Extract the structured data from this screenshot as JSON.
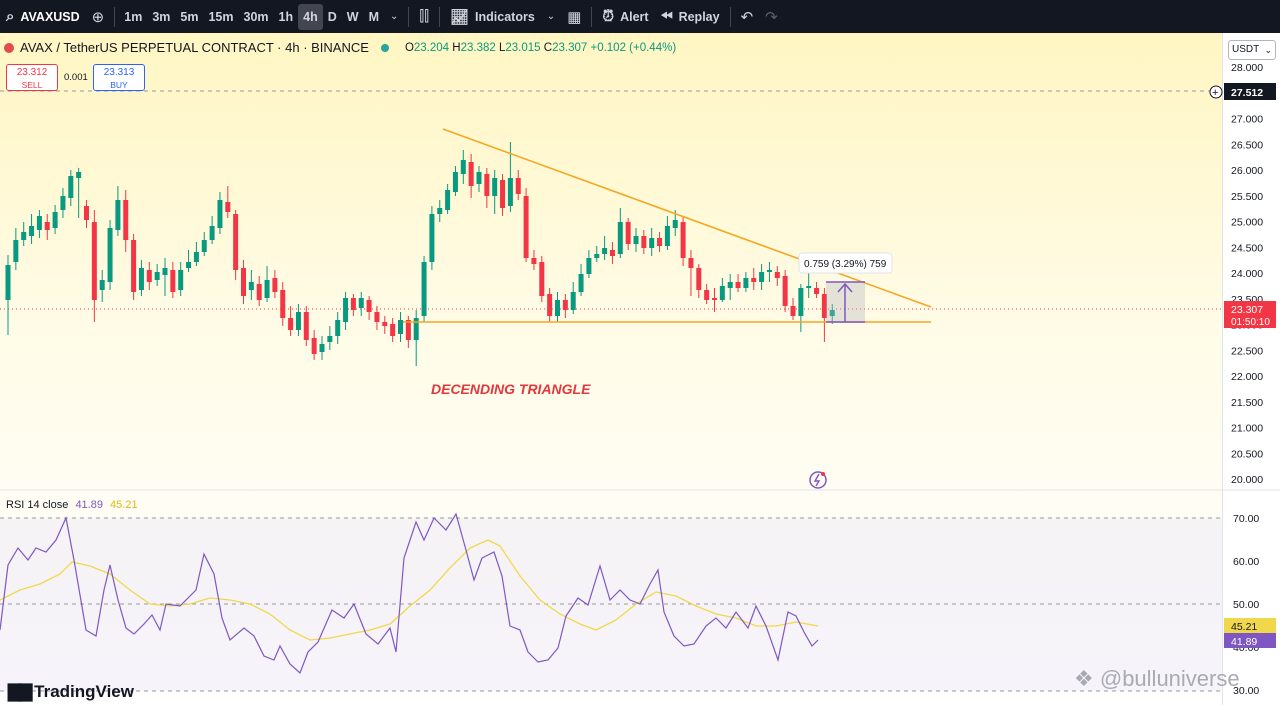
{
  "toolbar": {
    "symbol": "AVAXUSD",
    "intervals": [
      "1m",
      "3m",
      "5m",
      "15m",
      "30m",
      "1h",
      "4h",
      "D",
      "W",
      "M"
    ],
    "active_interval": "4h",
    "indicators_label": "Indicators",
    "alert_label": "Alert",
    "replay_label": "Replay"
  },
  "legend": {
    "title": "AVAX / TetherUS PERPETUAL CONTRACT · 4h · BINANCE",
    "o_label": "O",
    "o": "23.204",
    "h_label": "H",
    "h": "23.382",
    "l_label": "L",
    "l": "23.015",
    "c_label": "C",
    "c": "23.307",
    "change": "+0.102 (+0.44%)"
  },
  "trade": {
    "sell_price": "23.312",
    "sell_label": "SELL",
    "spread": "0.001",
    "buy_price": "23.313",
    "buy_label": "BUY"
  },
  "axis": {
    "currency": "USDT",
    "price_ticks": [
      "28.000",
      "27.500",
      "27.000",
      "26.500",
      "26.000",
      "25.500",
      "25.000",
      "24.500",
      "24.000",
      "23.500",
      "23.000",
      "22.500",
      "22.000",
      "21.500",
      "21.000",
      "20.500",
      "20.000"
    ],
    "crosshair_price": "27.512",
    "last_price": "23.307",
    "countdown": "01:50:10",
    "rsi_ticks": [
      "70.00",
      "60.00",
      "50.00",
      "40.00",
      "30.00"
    ],
    "rsi_value": "41.89",
    "rsi_ma_value": "45.21"
  },
  "annotation": {
    "pattern_label": "DECENDING TRIANGLE",
    "measure_label": "0.759 (3.29%) 759"
  },
  "rsi": {
    "label": "RSI 14 close",
    "value": "41.89",
    "ma_value": "45.21"
  },
  "branding": {
    "logo_text": "TradingView",
    "watermark": "@bulluniverse"
  },
  "colors": {
    "up": "#089981",
    "down": "#f23645",
    "trendline": "#f5a623",
    "rsi_line": "#7e57c2",
    "rsi_ma": "#f0d84a",
    "toolbar_bg": "#131722"
  }
}
